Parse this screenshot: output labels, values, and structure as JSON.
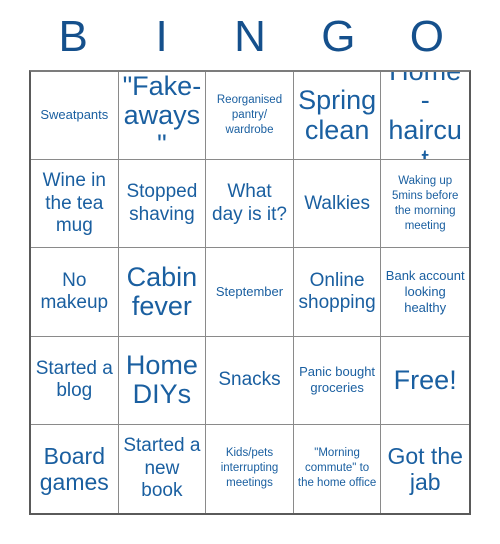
{
  "card": {
    "title_letters": [
      "B",
      "I",
      "N",
      "G",
      "O"
    ],
    "accent_color": "#15508c",
    "cell_text_color": "#1a5fa0",
    "grid_line_color": "#8a8a8a",
    "rows": 5,
    "columns": 5,
    "cells": [
      {
        "text": "Sweatpants",
        "size": "sm"
      },
      {
        "text": "\"Fake-aways\"",
        "size": "xl"
      },
      {
        "text": "Reorganised pantry/ wardrobe",
        "size": "xs"
      },
      {
        "text": "Spring clean",
        "size": "xl"
      },
      {
        "text": "Home-haircut",
        "size": "xl"
      },
      {
        "text": "Wine in the tea mug",
        "size": "md"
      },
      {
        "text": "Stopped shaving",
        "size": "md"
      },
      {
        "text": "What day is it?",
        "size": "md"
      },
      {
        "text": "Walkies",
        "size": "md"
      },
      {
        "text": "Waking up 5mins before the morning meeting",
        "size": "xs"
      },
      {
        "text": "No makeup",
        "size": "md"
      },
      {
        "text": "Cabin fever",
        "size": "xl"
      },
      {
        "text": "Steptember",
        "size": "sm"
      },
      {
        "text": "Online shopping",
        "size": "md"
      },
      {
        "text": "Bank account looking healthy",
        "size": "sm"
      },
      {
        "text": "Started a blog",
        "size": "md"
      },
      {
        "text": "Home DIYs",
        "size": "xl"
      },
      {
        "text": "Snacks",
        "size": "md"
      },
      {
        "text": "Panic bought groceries",
        "size": "sm"
      },
      {
        "text": "Free!",
        "size": "xl"
      },
      {
        "text": "Board games",
        "size": "lg"
      },
      {
        "text": "Started a new book",
        "size": "md"
      },
      {
        "text": "Kids/pets interrupting meetings",
        "size": "xs"
      },
      {
        "text": "\"Morning commute\" to the home office",
        "size": "xs"
      },
      {
        "text": "Got the jab",
        "size": "lg"
      }
    ]
  }
}
